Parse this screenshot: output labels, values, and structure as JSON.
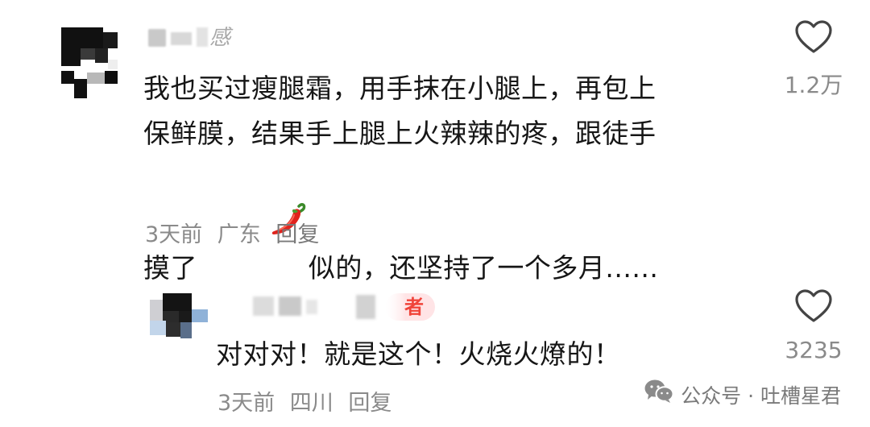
{
  "comments": [
    {
      "username_visible": "感",
      "text_lines": [
        "我也买过瘦腿霜，用手抹在小腿上，再包上",
        "保鲜膜，结果手上腿上火辣辣的疼，跟徒手",
        "摸了",
        "似的，还坚持了一个多月......"
      ],
      "inline_emoji": "chili-pepper-emoji",
      "time": "3天前",
      "location": "广东",
      "reply_label": "回复",
      "like_count": "1.2万",
      "like_icon": "heart-outline-icon"
    }
  ],
  "reply": {
    "badge": "者",
    "text": "对对对！就是这个！火烧火燎的！",
    "time": "3天前",
    "location": "四川",
    "reply_label": "回复",
    "like_count": "3235",
    "like_icon": "heart-outline-icon"
  },
  "watermark": {
    "icon": "wechat-icon",
    "text": "公众号 · 吐槽星君"
  },
  "colors": {
    "text": "#161616",
    "meta": "#8a8a8a",
    "badge_text": "#f0443a",
    "badge_bg": "#ffe4e6"
  }
}
